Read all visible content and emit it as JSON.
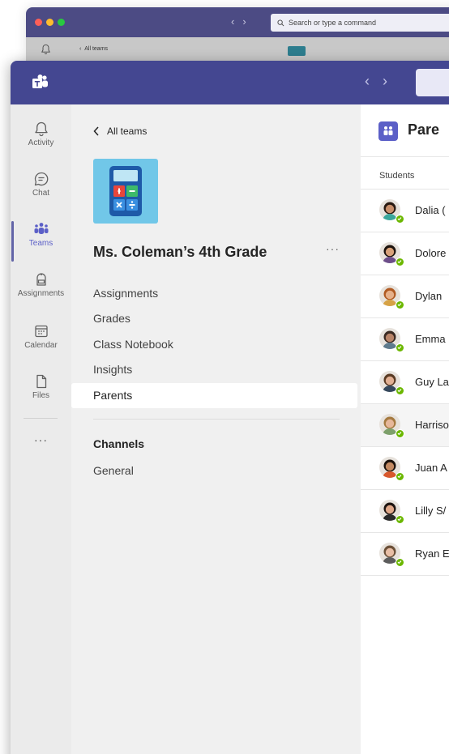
{
  "colors": {
    "title_bar": "#444791",
    "back_title_bar": "#4c4b84",
    "accent": "#6264a7",
    "presence_available": "#6bb700",
    "team_avatar_bg": "#71c7e8"
  },
  "back_window": {
    "search_placeholder": "Search or type a command",
    "back_link": "All teams"
  },
  "title_bar": {
    "logo_icon": "teams-logo-icon",
    "back_arrow": "‹",
    "forward_arrow": "›"
  },
  "app_rail": {
    "items": [
      {
        "label": "Activity",
        "icon": "bell-icon",
        "active": false
      },
      {
        "label": "Chat",
        "icon": "chat-icon",
        "active": false
      },
      {
        "label": "Teams",
        "icon": "teams-icon",
        "active": true
      },
      {
        "label": "Assignments",
        "icon": "assignments-icon",
        "active": false
      },
      {
        "label": "Calendar",
        "icon": "calendar-icon",
        "active": false
      },
      {
        "label": "Files",
        "icon": "file-icon",
        "active": false
      }
    ],
    "more_label": "···"
  },
  "team_panel": {
    "back_label": "All teams",
    "team_name": "Ms. Coleman’s 4th Grade",
    "more_label": "···",
    "nav_items": [
      {
        "label": "Assignments",
        "selected": false
      },
      {
        "label": "Grades",
        "selected": false
      },
      {
        "label": "Class Notebook",
        "selected": false
      },
      {
        "label": "Insights",
        "selected": false
      },
      {
        "label": "Parents",
        "selected": true
      }
    ],
    "channels_heading": "Channels",
    "channels": [
      {
        "label": "General"
      }
    ]
  },
  "main": {
    "title": "Pare",
    "section_label": "Students",
    "students": [
      {
        "name": "Dalia (",
        "skin": "#c98f6b",
        "hair": "#2a1a12",
        "shirt": "#3aa69b"
      },
      {
        "name": "Dolore",
        "skin": "#d9a27a",
        "hair": "#1e140e",
        "shirt": "#6d4e8a"
      },
      {
        "name": "Dylan",
        "skin": "#e6b08a",
        "hair": "#b05a22",
        "shirt": "#d6a245"
      },
      {
        "name": "Emma",
        "skin": "#b98468",
        "hair": "#3b2a22",
        "shirt": "#5e7a8c"
      },
      {
        "name": "Guy La",
        "skin": "#e2b093",
        "hair": "#5a3b24",
        "shirt": "#35485c"
      },
      {
        "name": "Harriso",
        "skin": "#e6b79a",
        "hair": "#a57a40",
        "shirt": "#7da06b"
      },
      {
        "name": "Juan A",
        "skin": "#c48a62",
        "hair": "#1c120c",
        "shirt": "#d8582c"
      },
      {
        "name": "Lilly S/",
        "skin": "#e0a889",
        "hair": "#1e1410",
        "shirt": "#2a2a2a"
      },
      {
        "name": "Ryan E",
        "skin": "#e8bea5",
        "hair": "#6b5038",
        "shirt": "#5c5c5c"
      }
    ],
    "hovered_index": 5
  }
}
